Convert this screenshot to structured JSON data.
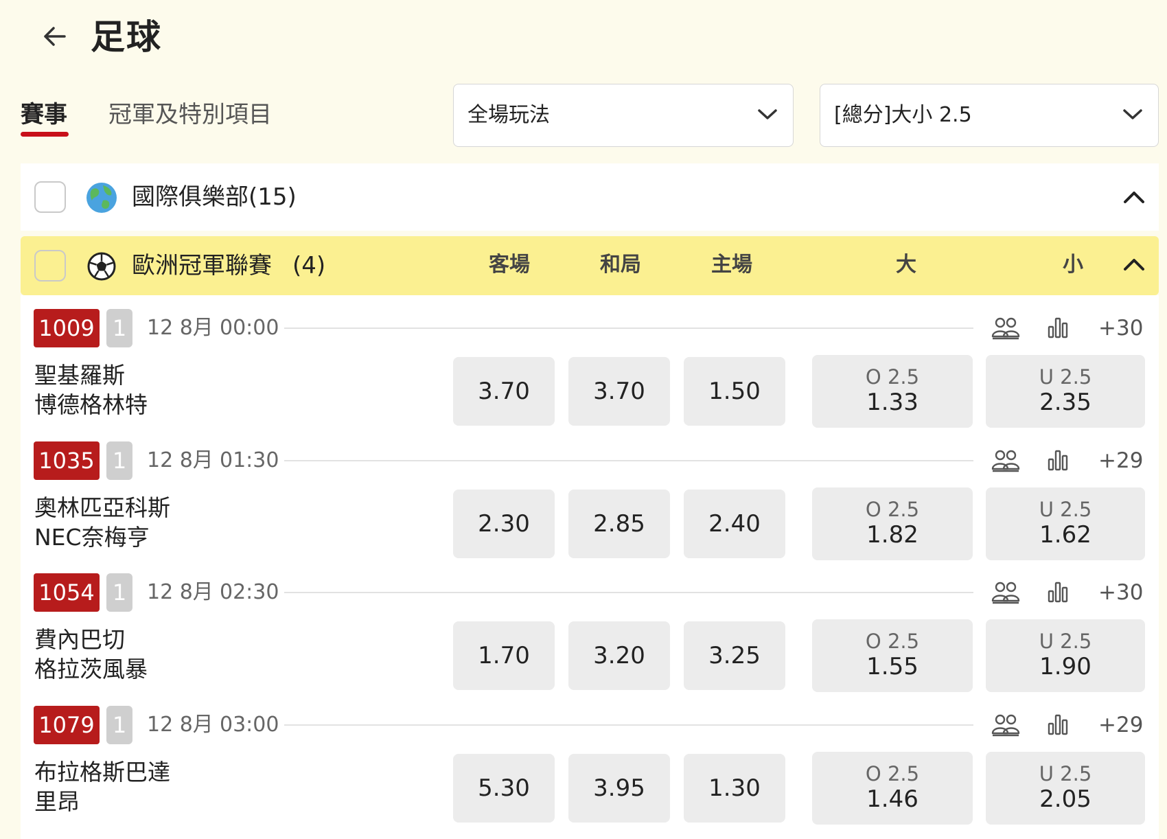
{
  "header": {
    "title": "足球"
  },
  "tabs": [
    {
      "label": "賽事"
    },
    {
      "label": "冠軍及特別項目"
    }
  ],
  "filters": {
    "market": "全場玩法",
    "line": "[總分]大小 2.5"
  },
  "leagues": [
    {
      "name": "國際俱樂部",
      "count": "(15)"
    },
    {
      "name": "歐洲冠軍聯賽",
      "count": "(4)",
      "columns": [
        "客場",
        "和局",
        "主場",
        "大",
        "小"
      ]
    }
  ],
  "matches": [
    {
      "id": "1009",
      "badge": "1",
      "date": "12 8月",
      "time": "00:00",
      "more": "+30",
      "team1": "聖基羅斯",
      "team2": "博德格林特",
      "away": "3.70",
      "draw": "3.70",
      "home": "1.50",
      "over_label": "O 2.5",
      "over": "1.33",
      "under_label": "U 2.5",
      "under": "2.35"
    },
    {
      "id": "1035",
      "badge": "1",
      "date": "12 8月",
      "time": "01:30",
      "more": "+29",
      "team1": "奧林匹亞科斯",
      "team2": "NEC奈梅亨",
      "away": "2.30",
      "draw": "2.85",
      "home": "2.40",
      "over_label": "O 2.5",
      "over": "1.82",
      "under_label": "U 2.5",
      "under": "1.62"
    },
    {
      "id": "1054",
      "badge": "1",
      "date": "12 8月",
      "time": "02:30",
      "more": "+30",
      "team1": "費內巴切",
      "team2": "格拉茨風暴",
      "away": "1.70",
      "draw": "3.20",
      "home": "3.25",
      "over_label": "O 2.5",
      "over": "1.55",
      "under_label": "U 2.5",
      "under": "1.90"
    },
    {
      "id": "1079",
      "badge": "1",
      "date": "12 8月",
      "time": "03:00",
      "more": "+29",
      "team1": "布拉格斯巴達",
      "team2": "里昂",
      "away": "5.30",
      "draw": "3.95",
      "home": "1.30",
      "over_label": "O 2.5",
      "over": "1.46",
      "under_label": "U 2.5",
      "under": "2.05"
    }
  ],
  "colors": {
    "accent": "#c8101a",
    "badge": "#b71c1c",
    "league_highlight": "#fbf091",
    "page_bg": "#fdfbec"
  },
  "icons": [
    "back-arrow-icon",
    "chevron-down-icon",
    "globe-icon",
    "soccer-ball-icon",
    "chevron-up-icon",
    "lineups-icon",
    "stats-icon"
  ]
}
